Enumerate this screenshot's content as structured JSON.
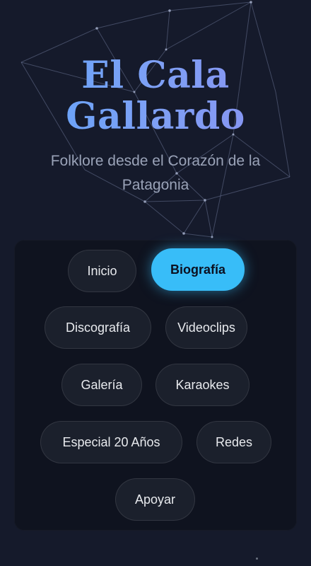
{
  "hero": {
    "title_line1": "El Cala",
    "title_line2": "Gallardo",
    "subtitle": "Folklore desde el Corazón de la Patagonia"
  },
  "nav": {
    "items": [
      {
        "label": "Inicio",
        "active": false
      },
      {
        "label": "Biografía",
        "active": true
      },
      {
        "label": "Discografía",
        "active": false
      },
      {
        "label": "Videoclips",
        "active": false
      },
      {
        "label": "Galería",
        "active": false
      },
      {
        "label": "Karaokes",
        "active": false
      },
      {
        "label": "Especial 20 Años",
        "active": false
      },
      {
        "label": "Redes",
        "active": false
      },
      {
        "label": "Apoyar",
        "active": false
      }
    ]
  },
  "colors": {
    "background": "#151a2b",
    "panel": "#0f131f",
    "active": "#38bdf8",
    "title_gradient_start": "#60a5fa",
    "title_gradient_end": "#8b8ff0"
  }
}
